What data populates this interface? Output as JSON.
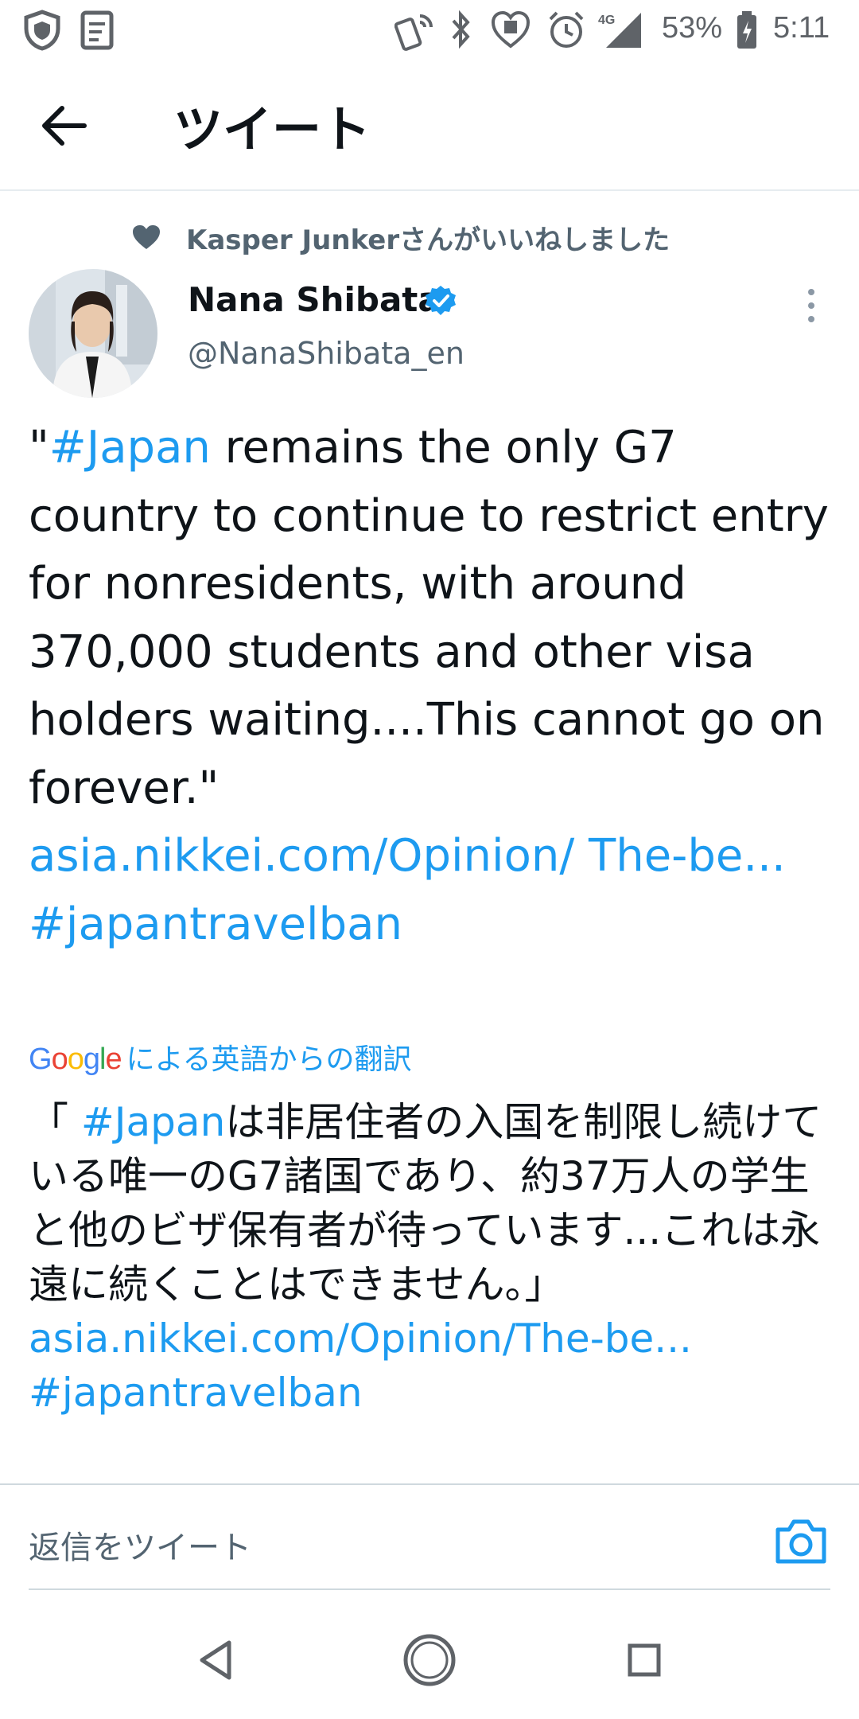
{
  "status_bar": {
    "network": "4G",
    "battery": "53%",
    "time": "5:11"
  },
  "header": {
    "title": "ツイート"
  },
  "social_context": {
    "text": "Kasper Junkerさんがいいねしました"
  },
  "author": {
    "name": "Nana Shibata",
    "handle": "@NanaShibata_en"
  },
  "tweet": {
    "quote_open": "\"",
    "hashtag1": "#Japan",
    "text1": " remains the only G7 country to continue to restrict entry for nonresidents, with around 370,000 students and other visa holders waiting....This cannot go on forever.\"",
    "link": "asia.nikkei.com/Opinion/ The-be...",
    "hashtag2": "#japantravelban"
  },
  "translation": {
    "label": "による英語からの翻訳",
    "open": "「 ",
    "hashtag1": "#Japan",
    "body": "は非居住者の入国を制限し続けている唯一のG7諸国であり、約37万人の学生と他のビザ保有者が待っています...これは永遠に続くことはできません。」",
    "link": "asia.nikkei.com/Opinion/The-be...",
    "hashtag2": " #japantravelban"
  },
  "reply": {
    "placeholder": "返信をツイート"
  },
  "colors": {
    "accent": "#1d9bf0",
    "text": "#0f1419",
    "muted": "#536471"
  }
}
